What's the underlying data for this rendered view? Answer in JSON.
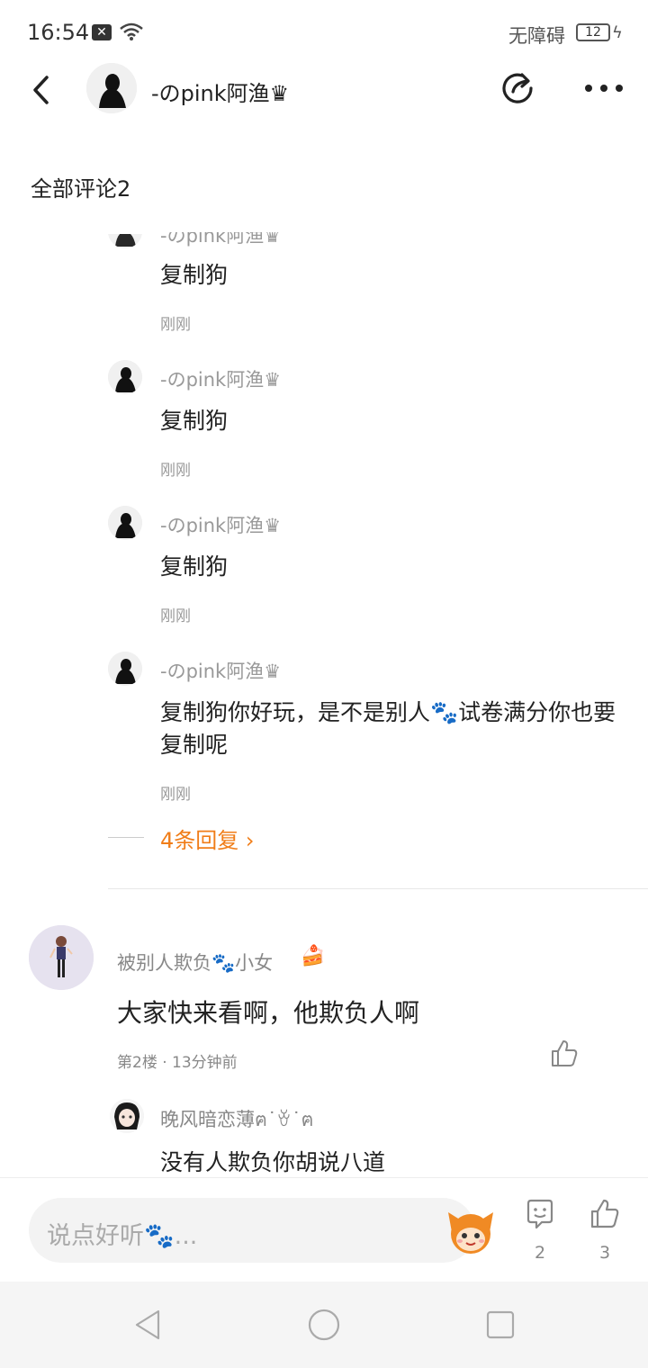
{
  "status": {
    "time": "16:54",
    "accessibility": "无障碍",
    "battery": "12"
  },
  "header": {
    "name": "-のpink阿渔♛"
  },
  "comments_title": "全部评论2",
  "thread_replies": [
    {
      "name": "-のpink阿渔♛",
      "text": "复制狗",
      "time": "刚刚"
    },
    {
      "name": "-のpink阿渔♛",
      "text": "复制狗",
      "time": "刚刚"
    },
    {
      "name": "-のpink阿渔♛",
      "text": "复制狗",
      "time": "刚刚"
    },
    {
      "name": "-のpink阿渔♛",
      "text": "复制狗你好玩，是不是别人🐾试卷满分你也要复制呢",
      "time": "刚刚"
    }
  ],
  "more_replies": "4条回复",
  "floor": {
    "name": "被别人欺负🐾小女",
    "badge": "🍰",
    "text": "大家快来看啊，他欺负人啊",
    "meta": "第2楼 · 13分钟前",
    "sub_reply": {
      "name": "晚风暗恋薄ฅ˙ꈊ˙ฅ",
      "text": "没有人欺负你胡说八道"
    }
  },
  "bottom": {
    "placeholder": "说点好听🐾...",
    "comment_count": "2",
    "like_count": "3"
  },
  "colors": {
    "accent": "#f07d18"
  }
}
